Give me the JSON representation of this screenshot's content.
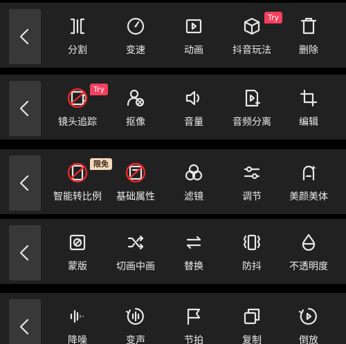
{
  "colors": {
    "panel": "#212121",
    "back_button": "#383838",
    "icon": "#e8e8e8",
    "try_badge": "#f53f5e",
    "free_badge": "#f5d9bd",
    "blocked_mark": "#e8282a"
  },
  "toolbars": [
    {
      "back_icon": "chevron-left-icon",
      "tools": [
        {
          "label": "分割",
          "icon": "split-icon"
        },
        {
          "label": "变速",
          "icon": "speed-gauge-icon"
        },
        {
          "label": "动画",
          "icon": "animation-play-icon"
        },
        {
          "label": "抖音玩法",
          "icon": "cube-icon",
          "badge": "Try"
        },
        {
          "label": "删除",
          "icon": "trash-icon"
        }
      ]
    },
    {
      "back_icon": "chevron-left-icon",
      "tools": [
        {
          "label": "镜头追踪",
          "icon": "camera-tracking-icon",
          "badge": "Try"
        },
        {
          "label": "抠像",
          "icon": "cutout-person-icon"
        },
        {
          "label": "音量",
          "icon": "speaker-icon"
        },
        {
          "label": "音频分离",
          "icon": "audio-separate-icon"
        },
        {
          "label": "编辑",
          "icon": "crop-icon"
        }
      ]
    },
    {
      "back_icon": "chevron-left-icon",
      "tools": [
        {
          "label": "智能转比例",
          "icon": "smart-ratio-icon",
          "badge": "限免"
        },
        {
          "label": "基础属性",
          "icon": "basic-properties-icon"
        },
        {
          "label": "滤镜",
          "icon": "filter-icon"
        },
        {
          "label": "调节",
          "icon": "adjust-sliders-icon"
        },
        {
          "label": "美颜美体",
          "icon": "beauty-icon"
        }
      ]
    },
    {
      "back_icon": "chevron-left-icon",
      "tools": [
        {
          "label": "蒙版",
          "icon": "mask-icon"
        },
        {
          "label": "切画中画",
          "icon": "shuffle-icon"
        },
        {
          "label": "替换",
          "icon": "replace-icon"
        },
        {
          "label": "防抖",
          "icon": "stabilize-icon"
        },
        {
          "label": "不透明度",
          "icon": "opacity-drop-icon"
        }
      ]
    },
    {
      "back_icon": "chevron-left-icon",
      "tools": [
        {
          "label": "降噪",
          "icon": "noise-reduction-icon"
        },
        {
          "label": "变声",
          "icon": "voice-change-icon"
        },
        {
          "label": "节拍",
          "icon": "beat-flag-icon"
        },
        {
          "label": "复制",
          "icon": "copy-icon"
        },
        {
          "label": "倒放",
          "icon": "reverse-icon"
        }
      ]
    }
  ]
}
